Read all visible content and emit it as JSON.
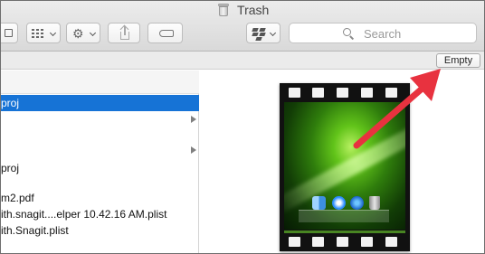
{
  "window": {
    "title": "Trash"
  },
  "toolbar": {
    "view_icon": "column-view-icon",
    "arrange_icon": "grid-icon",
    "action_icon": "gear-icon",
    "share_icon": "share-icon",
    "tag_icon": "tag-icon",
    "dropbox_icon": "dropbox-icon"
  },
  "search": {
    "placeholder": "Search"
  },
  "trash_bar": {
    "empty_label": "Empty"
  },
  "list": {
    "items": [
      {
        "label": "proj",
        "selected": true,
        "has_children": false
      },
      {
        "label": "",
        "selected": false,
        "has_children": true
      },
      {
        "label": "",
        "selected": false,
        "has_children": true
      },
      {
        "label": "proj",
        "selected": false,
        "has_children": false
      },
      {
        "label": "m2.pdf",
        "selected": false,
        "has_children": false
      },
      {
        "label": "ith.snagit....elper 10.42.16 AM.plist",
        "selected": false,
        "has_children": false
      },
      {
        "label": "ith.Snagit.plist",
        "selected": false,
        "has_children": false
      }
    ]
  },
  "preview": {
    "kind": "movie-file-thumbnail"
  },
  "colors": {
    "selection": "#1673d6",
    "annotation_arrow": "#e8323f",
    "toolbar_bg": "#dcdcdc"
  }
}
